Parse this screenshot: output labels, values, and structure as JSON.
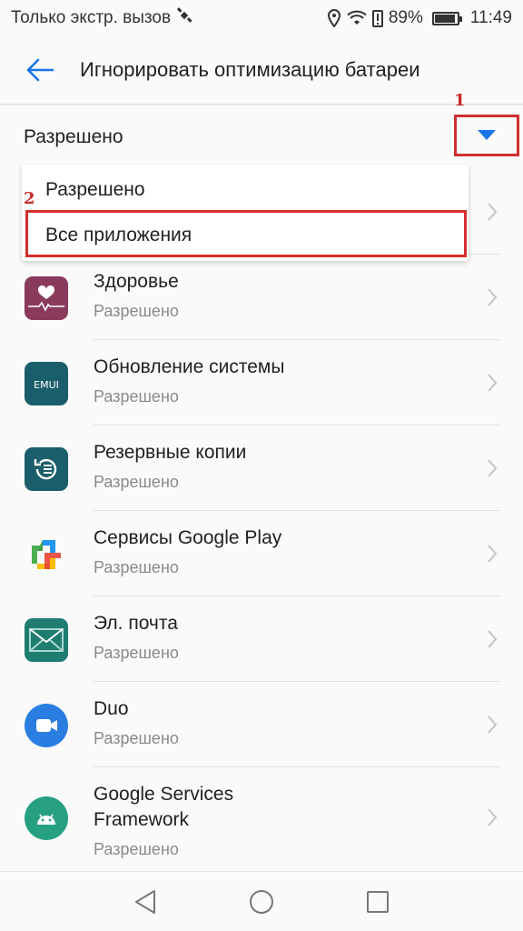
{
  "status_bar": {
    "carrier": "Только экстр. вызов",
    "battery": "89%",
    "time": "11:49"
  },
  "header": {
    "title": "Игнорировать оптимизацию батареи"
  },
  "filter": {
    "label": "Разрешено",
    "annotation": "1"
  },
  "dropdown": {
    "options": [
      "Разрешено",
      "Все приложения"
    ],
    "annotation": "2"
  },
  "apps": [
    {
      "name": "",
      "status": "",
      "icon": "hidden-app-icon"
    },
    {
      "name": "Здоровье",
      "status": "Разрешено",
      "icon": "health-app-icon"
    },
    {
      "name": "Обновление системы",
      "status": "Разрешено",
      "icon": "emui-update-icon"
    },
    {
      "name": "Резервные копии",
      "status": "Разрешено",
      "icon": "backup-icon"
    },
    {
      "name": "Сервисы Google Play",
      "status": "Разрешено",
      "icon": "google-play-services-icon"
    },
    {
      "name": "Эл. почта",
      "status": "Разрешено",
      "icon": "email-icon"
    },
    {
      "name": "Duo",
      "status": "Разрешено",
      "icon": "duo-icon"
    },
    {
      "name": "Google Services Framework",
      "name_lines": [
        "Google Services",
        "Framework"
      ],
      "status": "Разрешено",
      "icon": "android-icon"
    }
  ],
  "colors": {
    "accent": "#1a73e8",
    "annotation": "#d32f2f",
    "health": "#8a3b5c",
    "emui": "#1b5e6b",
    "backup": "#1b5e6b",
    "email": "#1e7d6e",
    "duo": "#2a7de1",
    "android": "#27a082"
  }
}
